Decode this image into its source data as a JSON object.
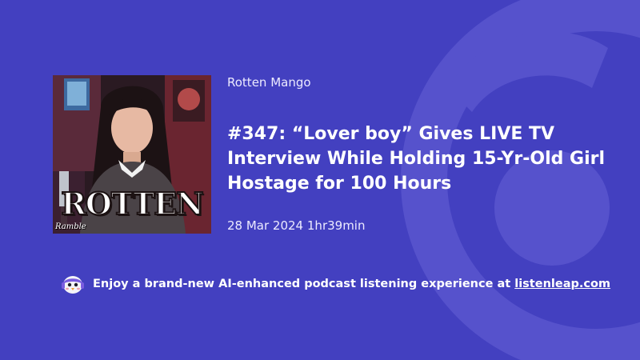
{
  "podcast": {
    "show_name": "Rotten Mango",
    "cover_word": "ROTTEN",
    "cover_brand": "Ramble",
    "cover_icon": "podcast-cover-art"
  },
  "episode": {
    "title": "#347: “Lover boy” Gives LIVE TV Interview While Holding 15-Yr-Old Girl Hostage for 100 Hours",
    "date": "28 Mar 2024",
    "duration": "1hr39min"
  },
  "promo": {
    "icon": "penguin-logo-icon",
    "text": "Enjoy a brand-new AI-enhanced podcast listening experience at",
    "link_text": "listenleap.com"
  },
  "colors": {
    "background": "#4340c0",
    "watermark": "#5b58cf",
    "text": "#ffffff"
  }
}
